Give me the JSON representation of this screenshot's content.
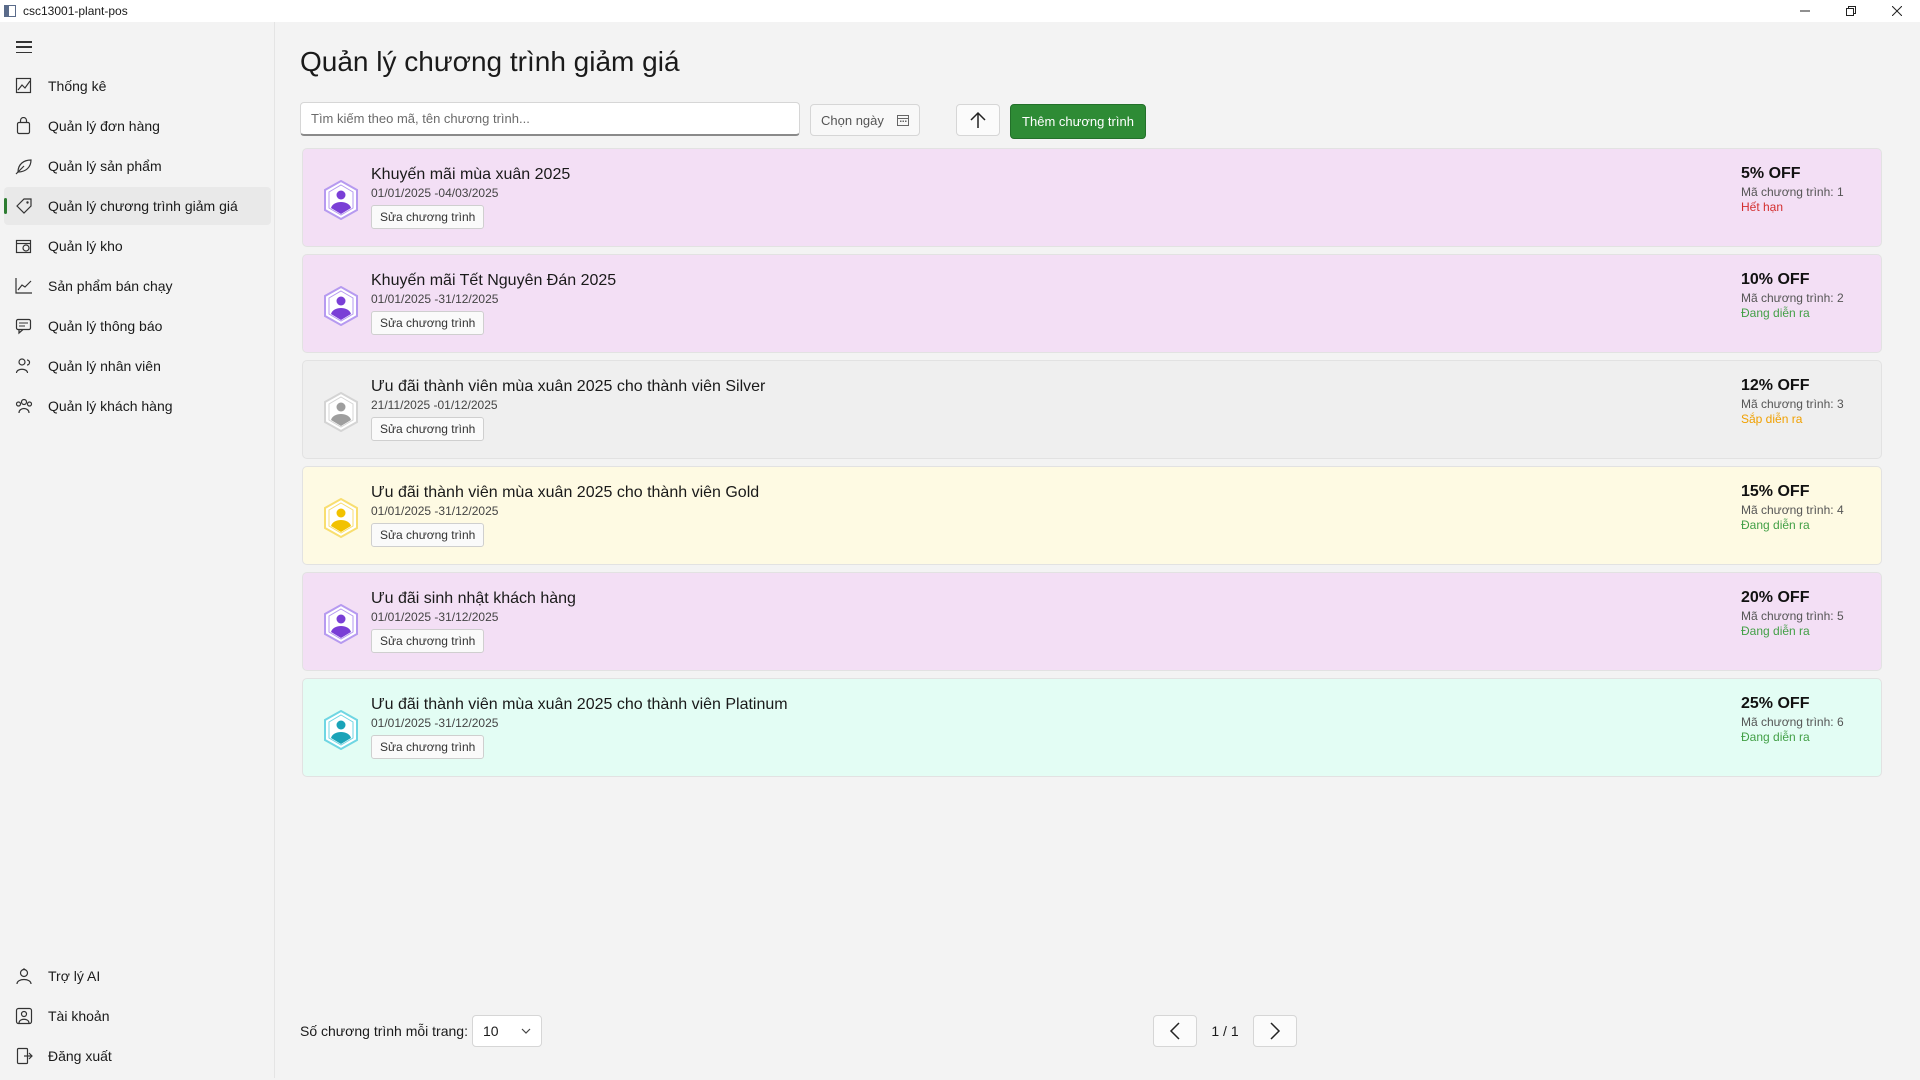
{
  "window": {
    "title": "csc13001-plant-pos"
  },
  "sidebar": {
    "menu_icon": "hamburger-icon",
    "items": [
      {
        "label": "Thống kê",
        "icon": "chart-icon",
        "active": false
      },
      {
        "label": "Quản lý đơn hàng",
        "icon": "bag-icon",
        "active": false
      },
      {
        "label": "Quản lý sản phẩm",
        "icon": "plant-icon",
        "active": false
      },
      {
        "label": "Quản lý chương trình giảm giá",
        "icon": "tag-icon",
        "active": true
      },
      {
        "label": "Quản lý kho",
        "icon": "warehouse-icon",
        "active": false
      },
      {
        "label": "Sản phẩm bán chạy",
        "icon": "trend-icon",
        "active": false
      },
      {
        "label": "Quản lý thông báo",
        "icon": "message-icon",
        "active": false
      },
      {
        "label": "Quản lý nhân viên",
        "icon": "people-icon",
        "active": false
      },
      {
        "label": "Quản lý khách hàng",
        "icon": "group-icon",
        "active": false
      }
    ],
    "bottom_items": [
      {
        "label": "Trợ lý AI",
        "icon": "assistant-icon"
      },
      {
        "label": "Tài khoản",
        "icon": "account-icon"
      },
      {
        "label": "Đăng xuất",
        "icon": "logout-icon"
      }
    ]
  },
  "page": {
    "title": "Quản lý chương trình giảm giá",
    "search_placeholder": "Tìm kiếm theo mã, tên chương trình...",
    "date_picker_label": "Chọn ngày",
    "add_button_label": "Thêm chương trình"
  },
  "colors": {
    "accent": "#2e8b35",
    "expired": "#d32f2f",
    "ongoing": "#43a047",
    "upcoming": "#f0a000"
  },
  "promotions": [
    {
      "name": "Khuyến mãi mùa xuân 2025",
      "dates": "01/01/2025 -04/03/2025",
      "edit_label": "Sửa chương trình",
      "off": "5% OFF",
      "code": "Mã chương trình: 1",
      "status": "Hết hạn",
      "status_color": "#d32f2f",
      "bg": "#f3dff5",
      "badge_color": "#7a3fd6",
      "badge_light": "#b69af0"
    },
    {
      "name": "Khuyến mãi Tết Nguyên Đán 2025",
      "dates": "01/01/2025 -31/12/2025",
      "edit_label": "Sửa chương trình",
      "off": "10% OFF",
      "code": "Mã chương trình: 2",
      "status": "Đang diễn ra",
      "status_color": "#43a047",
      "bg": "#f3dff5",
      "badge_color": "#7a3fd6",
      "badge_light": "#b69af0"
    },
    {
      "name": "Ưu đãi thành viên mùa xuân 2025 cho thành viên Silver",
      "dates": "21/11/2025 -01/12/2025",
      "edit_label": "Sửa chương trình",
      "off": "12% OFF",
      "code": "Mã chương trình: 3",
      "status": "Sắp diễn ra",
      "status_color": "#f0a000",
      "bg": "#efefef",
      "badge_color": "#9e9e9e",
      "badge_light": "#d4d4d4"
    },
    {
      "name": "Ưu đãi thành viên mùa xuân 2025 cho thành viên Gold",
      "dates": "01/01/2025 -31/12/2025",
      "edit_label": "Sửa chương trình",
      "off": "15% OFF",
      "code": "Mã chương trình: 4",
      "status": "Đang diễn ra",
      "status_color": "#43a047",
      "bg": "#fefae3",
      "badge_color": "#f2c200",
      "badge_light": "#f8de70"
    },
    {
      "name": "Ưu đãi sinh nhật khách hàng",
      "dates": "01/01/2025 -31/12/2025",
      "edit_label": "Sửa chương trình",
      "off": "20% OFF",
      "code": "Mã chương trình: 5",
      "status": "Đang diễn ra",
      "status_color": "#43a047",
      "bg": "#f3dff5",
      "badge_color": "#7a3fd6",
      "badge_light": "#b69af0"
    },
    {
      "name": "Ưu đãi thành viên mùa xuân 2025 cho thành viên Platinum",
      "dates": "01/01/2025 -31/12/2025",
      "edit_label": "Sửa chương trình",
      "off": "25% OFF",
      "code": "Mã chương trình: 6",
      "status": "Đang diễn ra",
      "status_color": "#43a047",
      "bg": "#e3fdf4",
      "badge_color": "#1aa3b8",
      "badge_light": "#6fd6e3"
    }
  ],
  "footer": {
    "page_size_label": "Số chương trình mỗi trang:",
    "page_size_value": "10",
    "page_indicator": "1 / 1"
  }
}
